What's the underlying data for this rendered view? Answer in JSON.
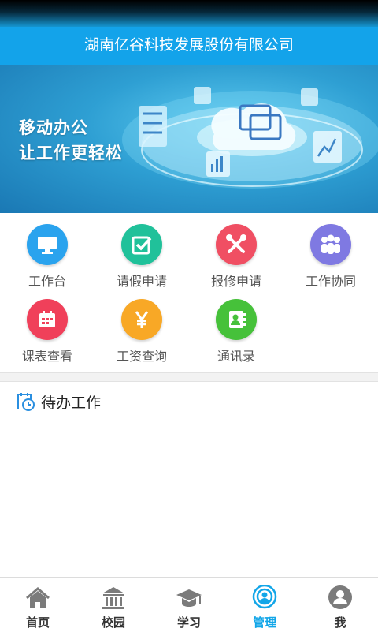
{
  "header": {
    "title": "湖南亿谷科技发展股份有限公司"
  },
  "banner": {
    "line1": "移动办公",
    "line2": "让工作更轻松"
  },
  "menu": [
    {
      "label": "工作台",
      "icon": "monitor-icon",
      "color": "#2aa3ee"
    },
    {
      "label": "请假申请",
      "icon": "checkbox-icon",
      "color": "#20c19a"
    },
    {
      "label": "报修申请",
      "icon": "tools-icon",
      "color": "#f04f63"
    },
    {
      "label": "工作协同",
      "icon": "team-icon",
      "color": "#7f79e2"
    },
    {
      "label": "课表查看",
      "icon": "calendar-icon",
      "color": "#f0405a"
    },
    {
      "label": "工资查询",
      "icon": "yen-icon",
      "color": "#f8a826"
    },
    {
      "label": "通讯录",
      "icon": "contacts-icon",
      "color": "#46c13a"
    }
  ],
  "todo": {
    "title": "待办工作",
    "icon": "clock-calendar-icon"
  },
  "tabs": [
    {
      "label": "首页",
      "icon": "home-icon"
    },
    {
      "label": "校园",
      "icon": "campus-icon"
    },
    {
      "label": "学习",
      "icon": "graduation-cap-icon"
    },
    {
      "label": "管理",
      "icon": "management-icon",
      "active": true
    },
    {
      "label": "我",
      "icon": "user-icon"
    }
  ],
  "colors": {
    "header": "#13a3ea",
    "active_tab": "#12a6e8",
    "tab_icon": "#7b7b7b"
  }
}
